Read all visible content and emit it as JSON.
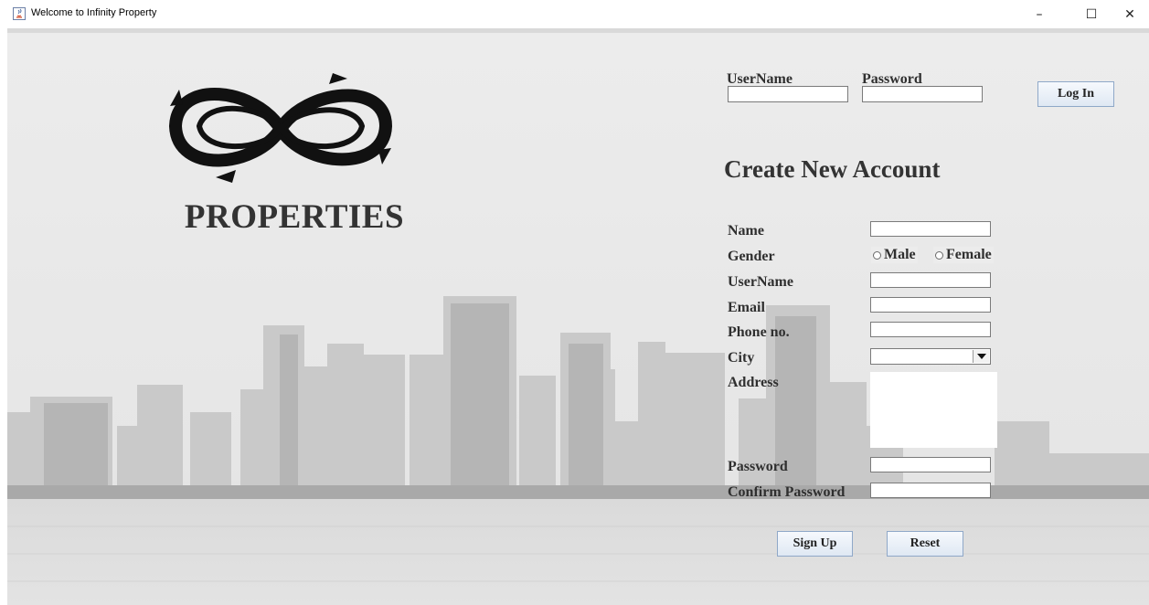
{
  "window": {
    "title": "Welcome to Infinity Property",
    "minimize_glyph": "–",
    "maximize_glyph": "☐",
    "close_glyph": "✕"
  },
  "branding": {
    "logo_icon": "infinity-arrows-logo",
    "name": "PROPERTIES"
  },
  "login": {
    "username_label": "UserName",
    "password_label": "Password",
    "username_value": "",
    "password_value": "",
    "login_button": "Log In"
  },
  "signup": {
    "title": "Create New Account",
    "name_label": "Name",
    "gender_label": "Gender",
    "gender_options": [
      "Male",
      "Female"
    ],
    "username_label": "UserName",
    "email_label": "Email",
    "phone_label": "Phone no.",
    "city_label": "City",
    "city_value": "",
    "address_label": "Address",
    "password_label": "Password",
    "confirm_password_label": "Confirm Password",
    "signup_button": "Sign Up",
    "reset_button": "Reset"
  },
  "colors": {
    "button_border": "#8fa8c8",
    "label_text": "#2f2f2f"
  }
}
